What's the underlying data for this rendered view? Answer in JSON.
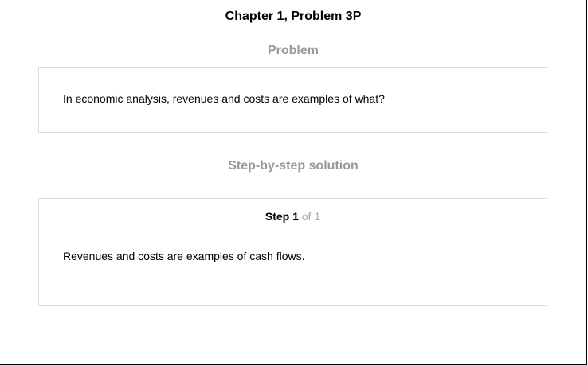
{
  "page": {
    "title": "Chapter 1, Problem 3P"
  },
  "problem": {
    "heading": "Problem",
    "text": "In economic analysis, revenues and costs are examples of what?"
  },
  "solution": {
    "heading": "Step-by-step solution",
    "step": {
      "label": "Step 1",
      "of_text": "of 1",
      "text": "Revenues and costs are examples of cash flows."
    }
  }
}
